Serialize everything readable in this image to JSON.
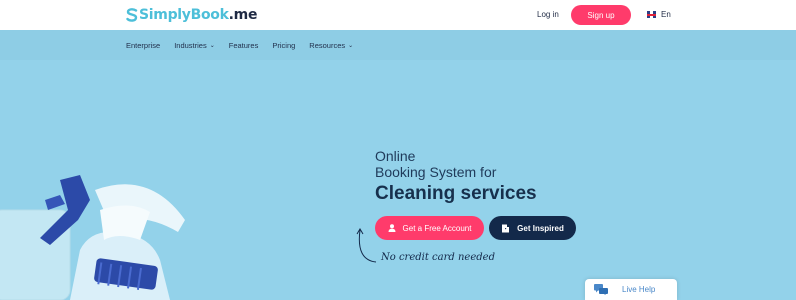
{
  "header": {
    "logo_word": "SimplyBook",
    "logo_suffix": ".me",
    "login_label": "Log in",
    "signup_label": "Sign up",
    "language_label": "En"
  },
  "nav": {
    "items": [
      {
        "label": "Enterprise",
        "dropdown": false
      },
      {
        "label": "Industries",
        "dropdown": true
      },
      {
        "label": "Features",
        "dropdown": false
      },
      {
        "label": "Pricing",
        "dropdown": false
      },
      {
        "label": "Resources",
        "dropdown": true
      }
    ]
  },
  "hero": {
    "line1": "Online",
    "line2": "Booking System for",
    "line3": "Cleaning services",
    "cta_primary": "Get a Free Account",
    "cta_secondary": "Get Inspired",
    "note": "No credit card needed"
  },
  "livehelp": {
    "label": "Live Help"
  },
  "colors": {
    "hero_bg": "#93d2ea",
    "accent_pink": "#ff3b6b",
    "navy": "#13294a",
    "logo_teal": "#4dbfd9"
  }
}
